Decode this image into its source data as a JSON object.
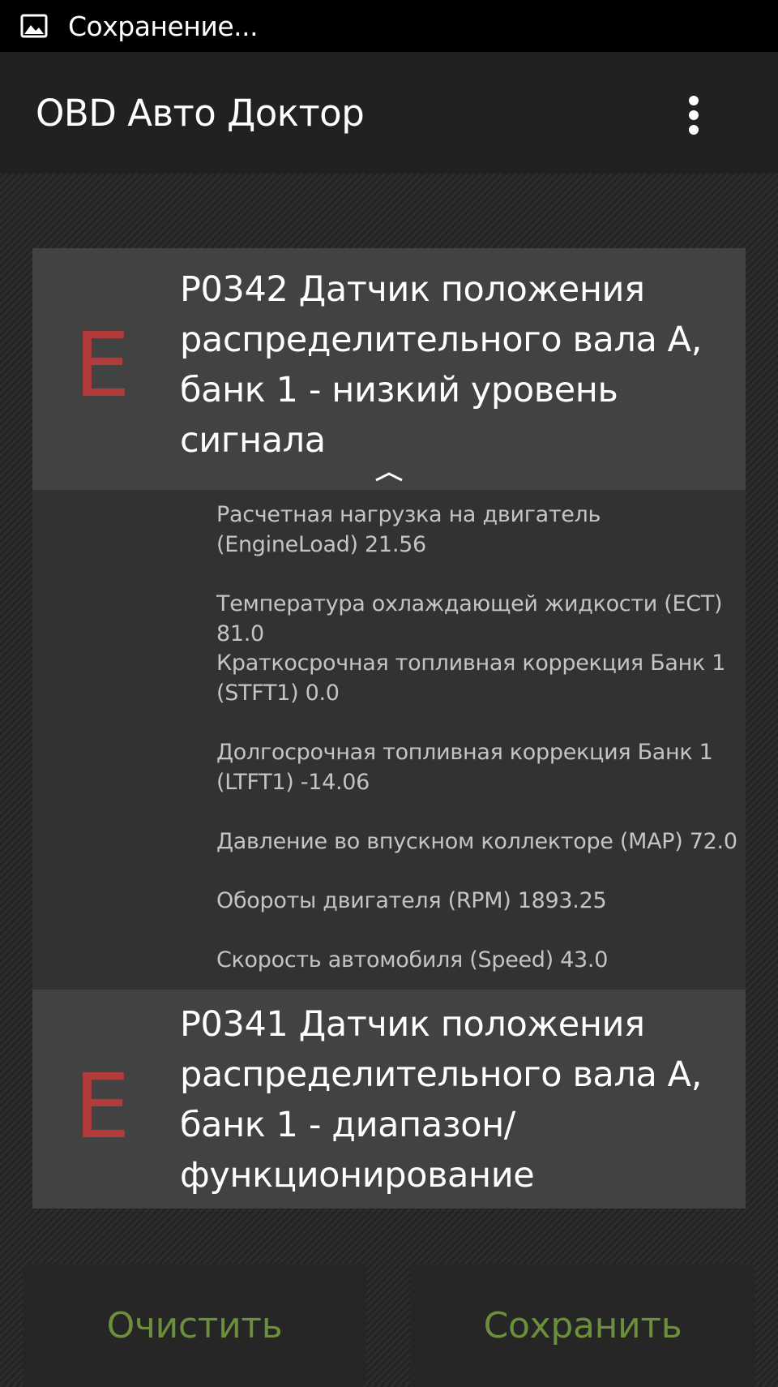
{
  "status_bar": {
    "text": "Сохранение...",
    "icon": "image-icon"
  },
  "app_bar": {
    "title": "OBD Авто Доктор",
    "menu_icon": "more-vert-icon"
  },
  "dtc_list": [
    {
      "letter": "E",
      "title": "P0342 Датчик положения распределительного вала А, банк 1 - низкий уровень сигнала",
      "expanded": true,
      "freeze_frame": [
        "Расчетная нагрузка на двигатель (EngineLoad) 21.56",
        "Температура охлаждающей жидкости (ECT) 81.0",
        "Краткосрочная топливная коррекция Банк 1 (STFT1) 0.0",
        "Долгосрочная топливная коррекция Банк 1 (LTFT1) -14.06",
        "Давление во впускном коллекторе (MAP) 72.0",
        "Обороты двигателя (RPM) 1893.25",
        "Скорость автомобиля (Speed) 43.0"
      ]
    },
    {
      "letter": "E",
      "title": "P0341 Датчик положения распределительного вала А, банк 1 - диапазон/функционирование",
      "expanded": false
    }
  ],
  "buttons": {
    "clear_label": "Очистить",
    "save_label": "Сохранить"
  },
  "colors": {
    "error_letter": "#b23b3b",
    "button_text": "#6c8f3c",
    "card_background": "#424242",
    "detail_background": "#323232"
  }
}
